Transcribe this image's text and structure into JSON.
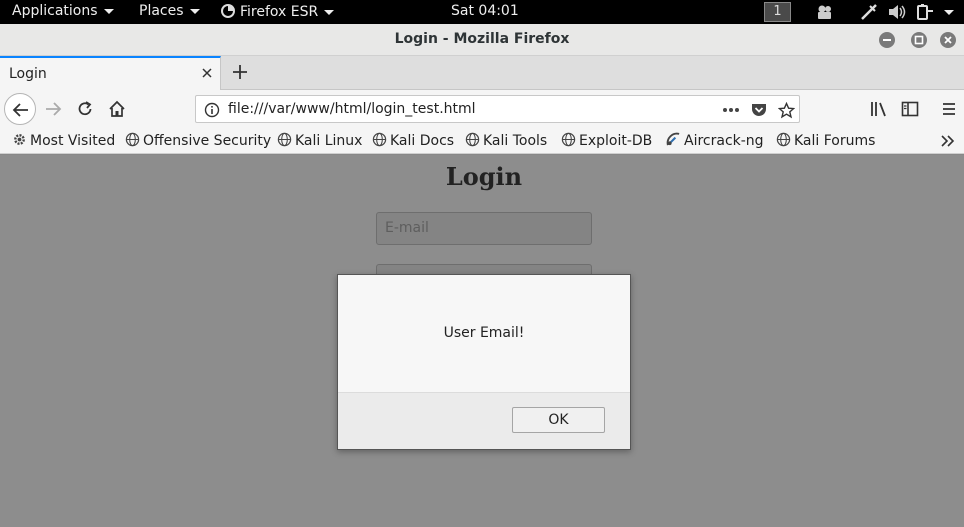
{
  "topbar": {
    "applications": "Applications",
    "places": "Places",
    "app_name": "Firefox ESR",
    "clock": "Sat 04:01",
    "workspace": "1"
  },
  "window": {
    "title": "Login - Mozilla Firefox"
  },
  "tabs": [
    {
      "label": "Login"
    }
  ],
  "navbar": {
    "url": "file:///var/www/html/login_test.html"
  },
  "bookmarks": [
    {
      "label": "Most Visited",
      "icon": "gear-icon"
    },
    {
      "label": "Offensive Security",
      "icon": "globe-icon"
    },
    {
      "label": "Kali Linux",
      "icon": "globe-icon"
    },
    {
      "label": "Kali Docs",
      "icon": "globe-icon"
    },
    {
      "label": "Kali Tools",
      "icon": "globe-icon"
    },
    {
      "label": "Exploit-DB",
      "icon": "globe-icon"
    },
    {
      "label": "Aircrack-ng",
      "icon": "satellite-icon"
    },
    {
      "label": "Kali Forums",
      "icon": "globe-icon"
    }
  ],
  "page": {
    "heading": "Login",
    "email_placeholder": "E-mail"
  },
  "dialog": {
    "message": "User Email!",
    "ok_label": "OK"
  },
  "colors": {
    "tab_accent": "#0a84ff",
    "page_overlay": "#8d8d8d",
    "topbar": "#000000"
  }
}
